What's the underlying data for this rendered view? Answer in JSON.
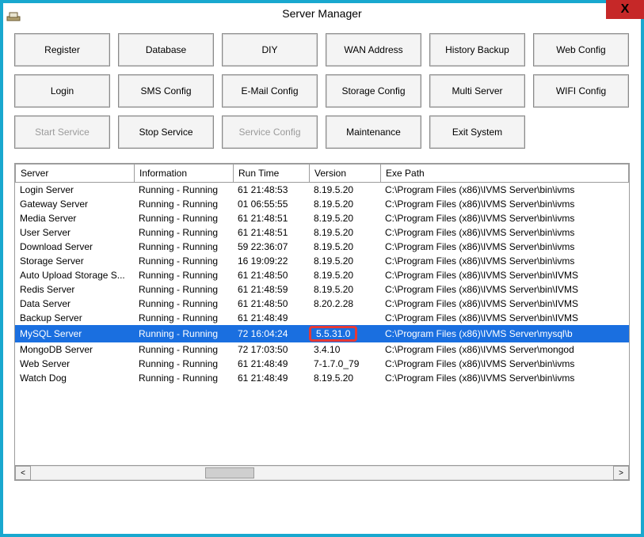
{
  "window": {
    "title": "Server Manager",
    "close": "X"
  },
  "buttons": {
    "row": [
      {
        "id": "register",
        "label": "Register",
        "enabled": true
      },
      {
        "id": "database",
        "label": "Database",
        "enabled": true
      },
      {
        "id": "diy",
        "label": "DIY",
        "enabled": true
      },
      {
        "id": "wan",
        "label": "WAN Address",
        "enabled": true
      },
      {
        "id": "history",
        "label": "History Backup",
        "enabled": true
      },
      {
        "id": "webcfg",
        "label": "Web Config",
        "enabled": true
      },
      {
        "id": "login",
        "label": "Login",
        "enabled": true
      },
      {
        "id": "smscfg",
        "label": "SMS Config",
        "enabled": true
      },
      {
        "id": "emailcfg",
        "label": "E-Mail Config",
        "enabled": true
      },
      {
        "id": "storagecfg",
        "label": "Storage Config",
        "enabled": true
      },
      {
        "id": "multiserver",
        "label": "Multi Server",
        "enabled": true
      },
      {
        "id": "wificfg",
        "label": "WIFI Config",
        "enabled": true
      },
      {
        "id": "startservice",
        "label": "Start Service",
        "enabled": false
      },
      {
        "id": "stopservice",
        "label": "Stop Service",
        "enabled": true
      },
      {
        "id": "servicecfg",
        "label": "Service Config",
        "enabled": false
      },
      {
        "id": "maintenance",
        "label": "Maintenance",
        "enabled": true
      },
      {
        "id": "exitsystem",
        "label": "Exit System",
        "enabled": true
      }
    ]
  },
  "table": {
    "headers": {
      "server": "Server",
      "info": "Information",
      "runtime": "Run Time",
      "version": "Version",
      "path": "Exe Path"
    },
    "rows": [
      {
        "server": "Login Server",
        "info": "Running - Running",
        "runtime": "61 21:48:53",
        "version": "8.19.5.20",
        "path": "C:\\Program Files (x86)\\IVMS Server\\bin\\ivms",
        "selected": false
      },
      {
        "server": "Gateway Server",
        "info": "Running - Running",
        "runtime": "01 06:55:55",
        "version": "8.19.5.20",
        "path": "C:\\Program Files (x86)\\IVMS Server\\bin\\ivms",
        "selected": false
      },
      {
        "server": "Media Server",
        "info": "Running - Running",
        "runtime": "61 21:48:51",
        "version": "8.19.5.20",
        "path": "C:\\Program Files (x86)\\IVMS Server\\bin\\ivms",
        "selected": false
      },
      {
        "server": "User Server",
        "info": "Running - Running",
        "runtime": "61 21:48:51",
        "version": "8.19.5.20",
        "path": "C:\\Program Files (x86)\\IVMS Server\\bin\\ivms",
        "selected": false
      },
      {
        "server": "Download Server",
        "info": "Running - Running",
        "runtime": "59 22:36:07",
        "version": "8.19.5.20",
        "path": "C:\\Program Files (x86)\\IVMS Server\\bin\\ivms",
        "selected": false
      },
      {
        "server": "Storage Server",
        "info": "Running - Running",
        "runtime": "16 19:09:22",
        "version": "8.19.5.20",
        "path": "C:\\Program Files (x86)\\IVMS Server\\bin\\ivms",
        "selected": false
      },
      {
        "server": "Auto Upload Storage S...",
        "info": "Running - Running",
        "runtime": "61 21:48:50",
        "version": "8.19.5.20",
        "path": "C:\\Program Files (x86)\\IVMS Server\\bin\\IVMS",
        "selected": false
      },
      {
        "server": "Redis Server",
        "info": "Running - Running",
        "runtime": "61 21:48:59",
        "version": "8.19.5.20",
        "path": "C:\\Program Files (x86)\\IVMS Server\\bin\\IVMS",
        "selected": false
      },
      {
        "server": "Data Server",
        "info": "Running - Running",
        "runtime": "61 21:48:50",
        "version": "8.20.2.28",
        "path": "C:\\Program Files (x86)\\IVMS Server\\bin\\IVMS",
        "selected": false
      },
      {
        "server": "Backup Server",
        "info": "Running - Running",
        "runtime": "61 21:48:49",
        "version": "",
        "path": "C:\\Program Files (x86)\\IVMS Server\\bin\\IVMS",
        "selected": false
      },
      {
        "server": "MySQL Server",
        "info": "Running - Running",
        "runtime": "72 16:04:24",
        "version": "5.5.31.0",
        "path": "C:\\Program Files (x86)\\IVMS Server\\mysql\\b",
        "selected": true,
        "highlightVersion": true
      },
      {
        "server": "MongoDB Server",
        "info": "Running - Running",
        "runtime": "72 17:03:50",
        "version": "3.4.10",
        "path": "C:\\Program Files (x86)\\IVMS Server\\mongod",
        "selected": false
      },
      {
        "server": "Web Server",
        "info": "Running - Running",
        "runtime": "61 21:48:49",
        "version": "7-1.7.0_79",
        "path": "C:\\Program Files (x86)\\IVMS Server\\bin\\ivms",
        "selected": false
      },
      {
        "server": "Watch Dog",
        "info": "Running - Running",
        "runtime": "61 21:48:49",
        "version": "8.19.5.20",
        "path": "C:\\Program Files (x86)\\IVMS Server\\bin\\ivms",
        "selected": false
      }
    ]
  },
  "scroll": {
    "left": "<",
    "right": ">"
  }
}
